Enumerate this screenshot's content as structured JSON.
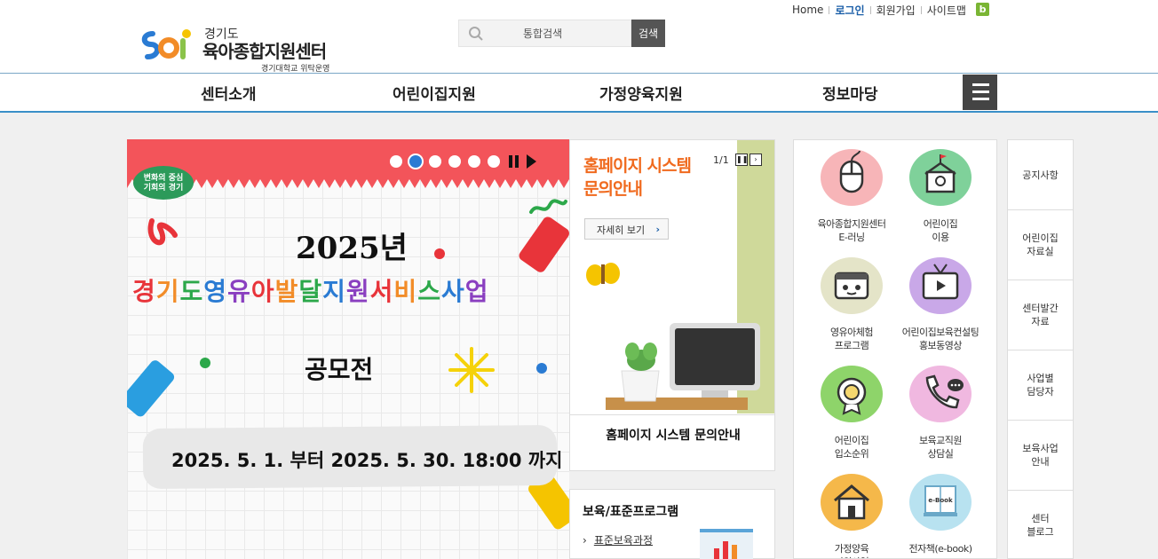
{
  "header": {
    "logo": {
      "small": "경기도",
      "big": "육아종합지원센터",
      "sub": "경기대학교 위탁운영"
    },
    "search": {
      "placeholder": "통합검색",
      "button": "검색"
    },
    "util": {
      "home": "Home",
      "login": "로그인",
      "join": "회원가입",
      "sitemap": "사이트맵",
      "blog_icon": "b"
    }
  },
  "gnb": {
    "items": [
      "센터소개",
      "어린이집지원",
      "가정양육지원",
      "정보마당"
    ],
    "menu_icon": "hamburger-icon"
  },
  "banner": {
    "badge": [
      "변화의 중심",
      "기회의 경기"
    ],
    "year": "2025년",
    "title": "경기도영유아발달지원서비스사업",
    "title_colors": [
      "#e8343a",
      "#f28c28",
      "#2ca84a",
      "#2a7bd3",
      "#8a3fc0",
      "#e8343a",
      "#f28c28",
      "#2ca84a",
      "#2a7bd3",
      "#8a3fc0",
      "#e8343a",
      "#f28c28",
      "#2ca84a",
      "#2a7bd3",
      "#8a3fc0"
    ],
    "subtitle": "공모전",
    "date": "2025. 5. 1. 부터  2025. 5. 30. 18:00 까지",
    "dots": 6,
    "active_dot": 1
  },
  "ad": {
    "title": [
      "홈페이지 시스템",
      "문의안내"
    ],
    "more": "자세히 보기",
    "count": "1/1",
    "caption": "홈페이지 시스템 문의안내"
  },
  "program": {
    "title": "보육/표준프로그램",
    "link": "표준보육과정"
  },
  "quick": [
    {
      "label": [
        "육아종합지원센터",
        "E-러닝"
      ],
      "color": "#f7b5b8",
      "icon": "mouse-icon"
    },
    {
      "label": [
        "어린이집",
        "이용"
      ],
      "color": "#7fd19a",
      "icon": "school-icon"
    },
    {
      "label": [
        "영유아체험",
        "프로그램"
      ],
      "color": "#e4e4c8",
      "icon": "toybox-icon"
    },
    {
      "label": [
        "어린이집보육컨설팅",
        "홍보동영상"
      ],
      "color": "#c9a8e8",
      "icon": "tv-icon"
    },
    {
      "label": [
        "어린이집",
        "입소순위"
      ],
      "color": "#8ed46a",
      "icon": "medal-icon"
    },
    {
      "label": [
        "보육교직원",
        "상담실"
      ],
      "color": "#f0b8e0",
      "icon": "phone-icon"
    },
    {
      "label": [
        "가정양육",
        "지원사업"
      ],
      "color": "#f5b84a",
      "icon": "house-icon"
    },
    {
      "label": [
        "전자책(e-book)",
        ""
      ],
      "color": "#b8e2f0",
      "icon": "ebook-icon",
      "ebook_text": "e-Book"
    }
  ],
  "side": [
    [
      "공지사항"
    ],
    [
      "어린이집",
      "자료실"
    ],
    [
      "센터발간",
      "자료"
    ],
    [
      "사업별",
      "담당자"
    ],
    [
      "보육사업",
      "안내"
    ],
    [
      "센터",
      "블로그"
    ]
  ]
}
